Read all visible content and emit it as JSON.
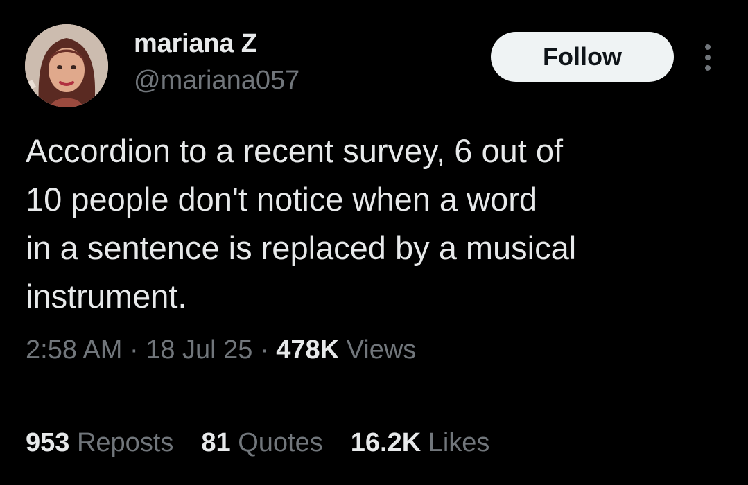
{
  "user": {
    "display_name": "mariana Z",
    "handle": "@mariana057"
  },
  "actions": {
    "follow_label": "Follow",
    "more_icon": "more-vertical-icon"
  },
  "tweet": {
    "lines": [
      "Accordion to a recent survey, 6 out of",
      "10 people don't notice when a word",
      "in a sentence is replaced by a musical",
      "instrument."
    ]
  },
  "meta": {
    "time": "2:58 AM",
    "separator": "·",
    "date": "18 Jul 25",
    "views_count": "478K",
    "views_label": "Views"
  },
  "stats": {
    "reposts_count": "953",
    "reposts_label": "Reposts",
    "quotes_count": "81",
    "quotes_label": "Quotes",
    "likes_count": "16.2K",
    "likes_label": "Likes"
  },
  "colors": {
    "background": "#000000",
    "primary_text": "#e7e9ea",
    "secondary_text": "#71767b",
    "button_bg": "#eff3f4",
    "divider": "#2f3336"
  }
}
